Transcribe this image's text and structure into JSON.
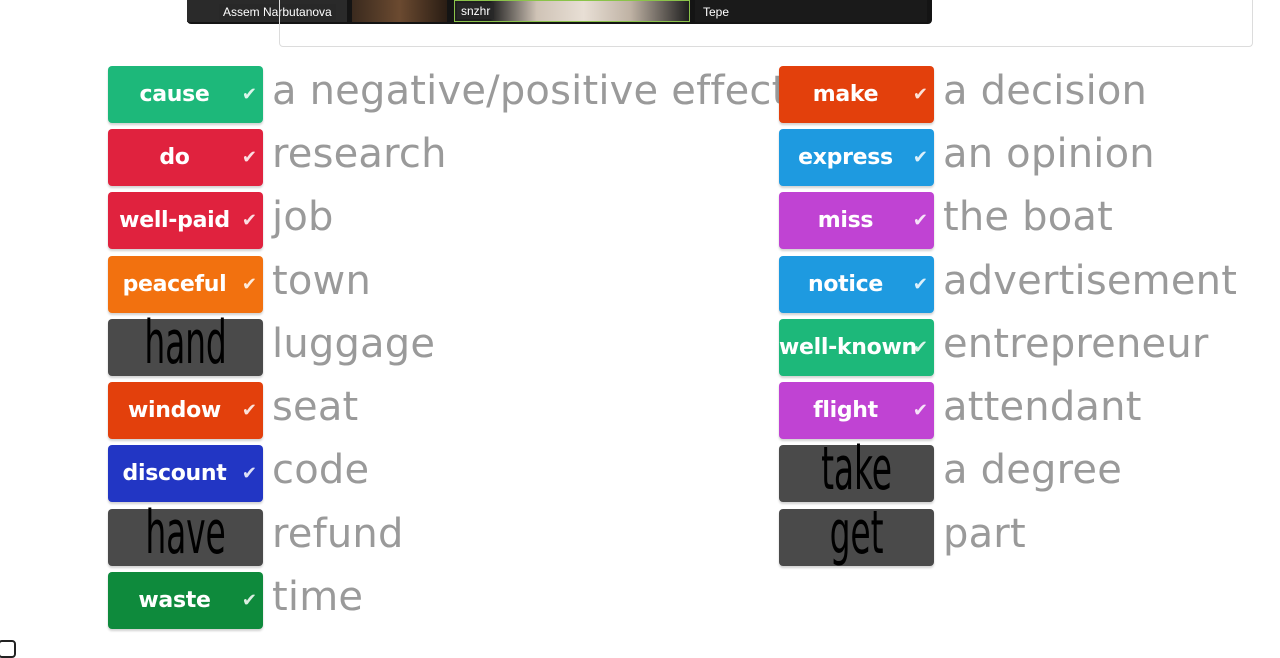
{
  "video_strip": {
    "participants": [
      "Assem Narbutanova",
      "snzhr",
      "Tepe"
    ]
  },
  "left_column": [
    {
      "word": "cause",
      "phrase": "a negative/positive effect",
      "color": "#1db87a",
      "style": "answered"
    },
    {
      "word": "do",
      "phrase": "research",
      "color": "#e0223e",
      "style": "answered"
    },
    {
      "word": "well-paid",
      "phrase": "job",
      "color": "#e0223e",
      "style": "answered"
    },
    {
      "word": "peaceful",
      "phrase": "town",
      "color": "#f2710f",
      "style": "answered"
    },
    {
      "word": "hand",
      "phrase": "luggage",
      "color": "#4a4a4a",
      "style": "handwritten"
    },
    {
      "word": "window",
      "phrase": "seat",
      "color": "#e3400c",
      "style": "answered"
    },
    {
      "word": "discount",
      "phrase": "code",
      "color": "#2236c4",
      "style": "answered"
    },
    {
      "word": "have",
      "phrase": "refund",
      "color": "#4a4a4a",
      "style": "handwritten"
    },
    {
      "word": "waste",
      "phrase": "time",
      "color": "#0e8a3c",
      "style": "answered"
    }
  ],
  "right_column": [
    {
      "word": "make",
      "phrase": "a decision",
      "color": "#e3400c",
      "style": "answered"
    },
    {
      "word": "express",
      "phrase": "an opinion",
      "color": "#1e9ae0",
      "style": "answered"
    },
    {
      "word": "miss",
      "phrase": "the boat",
      "color": "#c043d3",
      "style": "answered"
    },
    {
      "word": "notice",
      "phrase": "advertisement",
      "color": "#1e9ae0",
      "style": "answered"
    },
    {
      "word": "well-known",
      "phrase": "entrepreneur",
      "color": "#1db87a",
      "style": "answered"
    },
    {
      "word": "flight",
      "phrase": "attendant",
      "color": "#c043d3",
      "style": "answered"
    },
    {
      "word": "take",
      "phrase": "a degree",
      "color": "#4a4a4a",
      "style": "handwritten"
    },
    {
      "word": "get",
      "phrase": "part",
      "color": "#4a4a4a",
      "style": "handwritten"
    }
  ],
  "check_icon": "check-icon"
}
